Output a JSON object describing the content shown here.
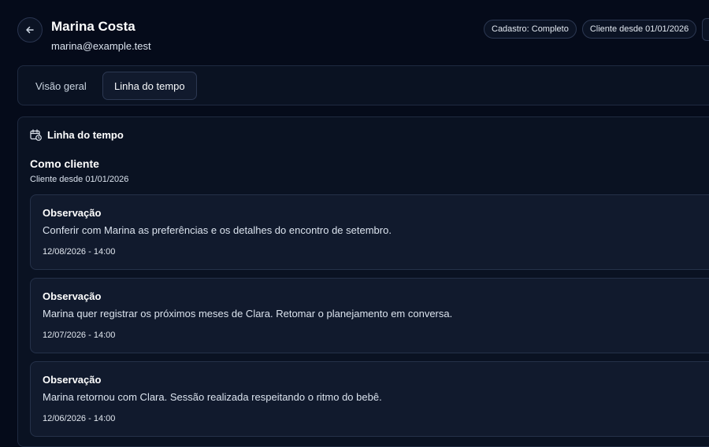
{
  "header": {
    "back_icon": "arrow-left-icon",
    "name": "Marina Costa",
    "email": "marina@example.test",
    "badges": [
      "Cadastro: Completo",
      "Cliente desde 01/01/2026"
    ]
  },
  "tabs": [
    {
      "label": "Visão geral",
      "active": false
    },
    {
      "label": "Linha do tempo",
      "active": true
    }
  ],
  "timeline": {
    "icon": "calendar-clock-icon",
    "title": "Linha do tempo",
    "group_title": "Como cliente",
    "group_subtitle": "Cliente desde 01/01/2026",
    "entries": [
      {
        "title": "Observação",
        "text": "Conferir com Marina as preferências e os detalhes do encontro de setembro.",
        "date": "12/08/2026 - 14:00"
      },
      {
        "title": "Observação",
        "text": "Marina quer registrar os próximos meses de Clara. Retomar o planejamento em conversa.",
        "date": "12/07/2026 - 14:00"
      },
      {
        "title": "Observação",
        "text": "Marina retornou com Clara. Sessão realizada respeitando o ritmo do bebê.",
        "date": "12/06/2026 - 14:00"
      }
    ]
  },
  "colors": {
    "background": "#050b1a",
    "card": "#0a1222",
    "entry": "#111a2d",
    "border": "#253149"
  }
}
